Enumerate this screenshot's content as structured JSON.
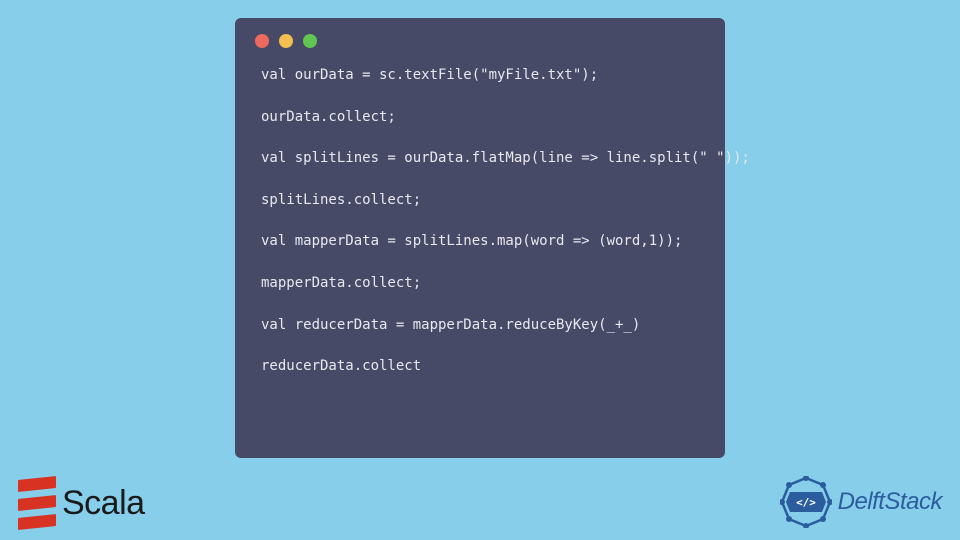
{
  "code": {
    "lines": [
      "val ourData = sc.textFile(\"myFile.txt\");",
      "ourData.collect;",
      "val splitLines = ourData.flatMap(line => line.split(\" \"));",
      "splitLines.collect;",
      "val mapperData = splitLines.map(word => (word,1));",
      "mapperData.collect;",
      "val reducerData = mapperData.reduceByKey(_+_)",
      "reducerData.collect"
    ]
  },
  "logos": {
    "scala_text": "Scala",
    "delftstack_text": "DelftStack"
  }
}
